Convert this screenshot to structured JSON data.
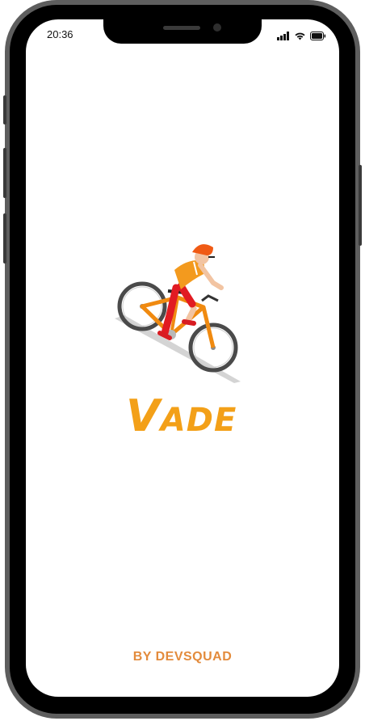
{
  "status_bar": {
    "time": "20:36",
    "icons": [
      "cellular-signal-icon",
      "wifi-icon",
      "battery-icon"
    ]
  },
  "splash": {
    "logo_first_letter": "V",
    "logo_rest": "ADE",
    "byline": "BY DEVSQUAD",
    "illustration": "cyclist-on-bicycle"
  },
  "colors": {
    "brand_orange": "#f3a018",
    "byline_orange": "#e38b3c",
    "frame": "#5e5e5e",
    "bezel": "#000000",
    "screen_bg": "#ffffff"
  }
}
